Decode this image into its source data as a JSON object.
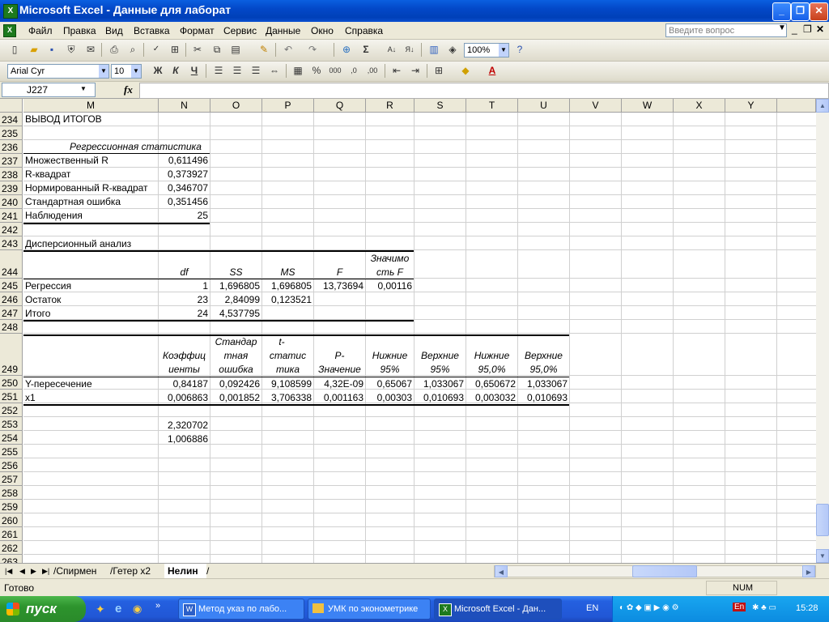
{
  "window": {
    "title": "Microsoft Excel - Данные для лаборат",
    "icon": "excel-icon"
  },
  "menu": {
    "items": [
      "Файл",
      "Правка",
      "Вид",
      "Вставка",
      "Формат",
      "Сервис",
      "Данные",
      "Окно",
      "Справка"
    ],
    "ask_placeholder": "Введите вопрос"
  },
  "toolbar": {
    "zoom": "100%",
    "font": "Arial Cyr",
    "font_size": "10",
    "bold": "Ж",
    "italic": "К",
    "underline": "Ч",
    "percent": "%",
    "thousands": "000"
  },
  "formula_bar": {
    "cell_ref": "J227",
    "fx": "fx",
    "content": ""
  },
  "columns": [
    "M",
    "N",
    "O",
    "P",
    "Q",
    "R",
    "S",
    "T",
    "U",
    "V",
    "W",
    "X",
    "Y"
  ],
  "rows": [
    "234",
    "235",
    "236",
    "237",
    "238",
    "239",
    "240",
    "241",
    "242",
    "243",
    "244",
    "245",
    "246",
    "247",
    "248",
    "249",
    "250",
    "251",
    "252",
    "253",
    "254",
    "255",
    "256",
    "257",
    "258",
    "259",
    "260",
    "261",
    "262",
    "263"
  ],
  "cells": {
    "r234": "ВЫВОД ИТОГОВ",
    "r236": "Регрессионная статистика",
    "stats": [
      {
        "label": "Множественный R",
        "value": "0,611496"
      },
      {
        "label": "R-квадрат",
        "value": "0,373927"
      },
      {
        "label": "Нормированный R-квадрат",
        "value": "0,346707"
      },
      {
        "label": "Стандартная ошибка",
        "value": "0,351456"
      },
      {
        "label": "Наблюдения",
        "value": "25"
      }
    ],
    "r243": "Дисперсионный анализ",
    "anova_header": {
      "df": "df",
      "ss": "SS",
      "ms": "MS",
      "f": "F",
      "sig_line1": "Значимо",
      "sig_line2": "сть F"
    },
    "anova": [
      {
        "label": "Регрессия",
        "df": "1",
        "ss": "1,696805",
        "ms": "1,696805",
        "f": "13,73694",
        "sig": "0,00116"
      },
      {
        "label": "Остаток",
        "df": "23",
        "ss": "2,84099",
        "ms": "0,123521",
        "f": "",
        "sig": ""
      },
      {
        "label": "Итого",
        "df": "24",
        "ss": "4,537795",
        "ms": "",
        "f": "",
        "sig": ""
      }
    ],
    "coef_header": {
      "n": [
        "Коэффиц",
        "иенты"
      ],
      "o": [
        "Стандар",
        "тная",
        "ошибка"
      ],
      "p": [
        "t-",
        "статис",
        "тика"
      ],
      "q": [
        "P-",
        "Значение"
      ],
      "r": [
        "Нижние",
        "95%"
      ],
      "s": [
        "Верхние",
        "95%"
      ],
      "t": [
        "Нижние",
        "95,0%"
      ],
      "u": [
        "Верхние",
        "95,0%"
      ]
    },
    "coef": [
      {
        "label": "Y-пересечение",
        "n": "0,84187",
        "o": "0,092426",
        "p": "9,108599",
        "q": "4,32E-09",
        "r": "0,65067",
        "s": "1,033067",
        "t": "0,650672",
        "u": "1,033067"
      },
      {
        "label": "x1",
        "n": "0,006863",
        "o": "0,001852",
        "p": "3,706338",
        "q": "0,001163",
        "r": "0,00303",
        "s": "0,010693",
        "t": "0,003032",
        "u": "0,010693"
      }
    ],
    "r253": "2,320702",
    "r254": "1,006886"
  },
  "sheets": {
    "tabs": [
      "Спирмен",
      "Гетер х2",
      "Нелин"
    ],
    "active": "Нелин"
  },
  "status": {
    "left": "Готово",
    "num": "NUM"
  },
  "taskbar": {
    "start": "пуск",
    "tasks": [
      "Метод указ по лабо...",
      "УМК по эконометрике",
      "Microsoft Excel - Дан..."
    ],
    "lang": "EN",
    "tray_lang": "En",
    "clock": "15:28"
  }
}
